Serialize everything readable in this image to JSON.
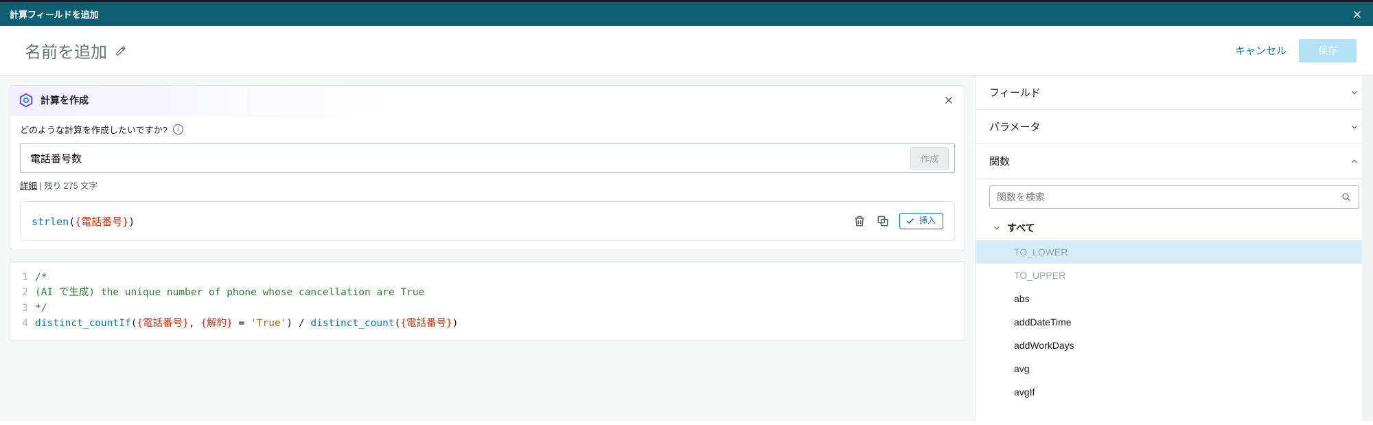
{
  "titlebar": {
    "title": "計算フィールドを追加"
  },
  "name_row": {
    "placeholder": "名前を追加",
    "cancel": "キャンセル",
    "save": "保存"
  },
  "ai_panel": {
    "header": "計算を作成",
    "prompt_label": "どのような計算を作成したいですか?",
    "prompt_value": "電話番号数",
    "create_btn": "作成",
    "detail_link": "詳細",
    "detail_rest": " | 残り 275 文字",
    "suggestion": {
      "fn": "strlen",
      "field": "電話番号",
      "insert_label": "挿入"
    }
  },
  "editor": {
    "lines": [
      {
        "n": 1,
        "type": "comment",
        "text": "/*"
      },
      {
        "n": 2,
        "type": "comment",
        "text": "(AI で生成) the unique number of phone whose cancellation are True"
      },
      {
        "n": 3,
        "type": "comment",
        "text": "*/"
      },
      {
        "n": 4,
        "type": "expr",
        "tokens": [
          {
            "t": "fn",
            "v": "distinct_countIf"
          },
          {
            "t": "punct",
            "v": "("
          },
          {
            "t": "field",
            "v": "{電話番号}"
          },
          {
            "t": "punct",
            "v": ", "
          },
          {
            "t": "field",
            "v": "{解約}"
          },
          {
            "t": "op",
            "v": " = "
          },
          {
            "t": "str",
            "v": "'True'"
          },
          {
            "t": "punct",
            "v": ") "
          },
          {
            "t": "op",
            "v": "/ "
          },
          {
            "t": "fn",
            "v": "distinct_count"
          },
          {
            "t": "punct",
            "v": "("
          },
          {
            "t": "field",
            "v": "{電話番号}"
          },
          {
            "t": "punct",
            "v": ")"
          }
        ]
      }
    ]
  },
  "right": {
    "accordions": {
      "fields": "フィールド",
      "parameters": "パラメータ",
      "functions": "関数"
    },
    "search_placeholder": "関数を検索",
    "group_all": "すべて",
    "fns": [
      {
        "name": "TO_LOWER",
        "dim": true,
        "selected": true
      },
      {
        "name": "TO_UPPER",
        "dim": true,
        "selected": false
      },
      {
        "name": "abs",
        "dim": false,
        "selected": false
      },
      {
        "name": "addDateTime",
        "dim": false,
        "selected": false
      },
      {
        "name": "addWorkDays",
        "dim": false,
        "selected": false
      },
      {
        "name": "avg",
        "dim": false,
        "selected": false
      },
      {
        "name": "avgIf",
        "dim": false,
        "selected": false
      }
    ]
  }
}
